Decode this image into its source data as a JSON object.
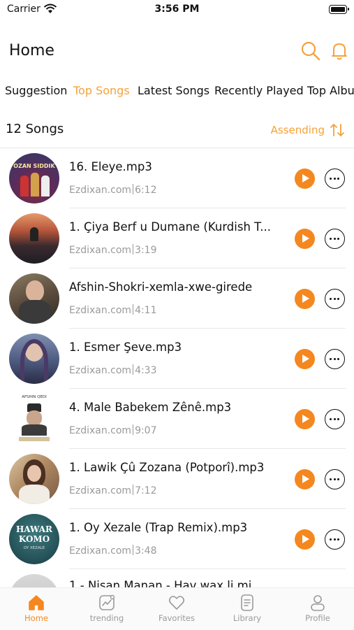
{
  "status": {
    "carrier": "Carrier",
    "time": "3:56 PM"
  },
  "header": {
    "title": "Home"
  },
  "tabs": [
    {
      "label": "Suggestion",
      "active": false
    },
    {
      "label": "Top Songs",
      "active": true
    },
    {
      "label": "Latest Songs",
      "active": false
    },
    {
      "label": "Recently Played",
      "active": false
    },
    {
      "label": "Top Albu",
      "active": false
    }
  ],
  "list_header": {
    "count": "12 Songs",
    "sort_label": "Assending"
  },
  "songs": [
    {
      "title": "16. Eleye.mp3",
      "source": "Ezdixan.com",
      "duration": "6:12"
    },
    {
      "title": "1. Çiya Berf u Dumane (Kurdish T...",
      "source": "Ezdixan.com",
      "duration": "3:19"
    },
    {
      "title": "Afshin-Shokri-xemla-xwe-girede",
      "source": "Ezdixan.com",
      "duration": "4:11"
    },
    {
      "title": "1. Esmer Şeve.mp3",
      "source": "Ezdixan.com",
      "duration": "4:33"
    },
    {
      "title": "4. Male Babekem Zênê.mp3",
      "source": "Ezdixan.com",
      "duration": "9:07"
    },
    {
      "title": "1. Lawik Çû Zozana (Potporî).mp3",
      "source": "Ezdixan.com",
      "duration": "7:12"
    },
    {
      "title": "1. Oy Xezale (Trap Remix).mp3",
      "source": "Ezdixan.com",
      "duration": "3:48"
    },
    {
      "title": "1 - Nisan Manan - Hav wax li mi",
      "source": "",
      "duration": ""
    }
  ],
  "art_text": {
    "a1": "OZAN SIDDIK",
    "a5": "AFSHIN QEDI",
    "a7_line1": "HAWAR",
    "a7_line2": "KOMO",
    "a7_line3": "OY XEZALE"
  },
  "bottom_nav": [
    {
      "label": "Home",
      "icon": "home-icon",
      "active": true
    },
    {
      "label": "trending",
      "icon": "trending-icon",
      "active": false
    },
    {
      "label": "Favorites",
      "icon": "heart-icon",
      "active": false
    },
    {
      "label": "Library",
      "icon": "library-icon",
      "active": false
    },
    {
      "label": "Profile",
      "icon": "profile-icon",
      "active": false
    }
  ],
  "colors": {
    "accent": "#f5871f",
    "accent_light": "#f5a23a",
    "muted": "#9a9a9a"
  }
}
